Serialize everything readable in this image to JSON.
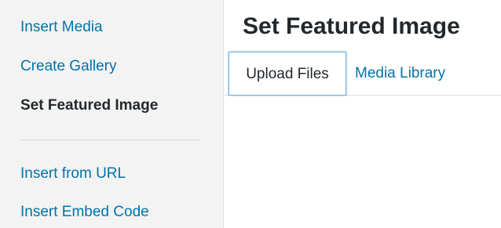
{
  "sidebar": {
    "items": [
      {
        "label": "Insert Media"
      },
      {
        "label": "Create Gallery"
      },
      {
        "label": "Set Featured Image"
      },
      {
        "label": "Insert from URL"
      },
      {
        "label": "Insert Embed Code"
      }
    ],
    "active_item": "Set Featured Image"
  },
  "frame": {
    "title": "Set Featured Image"
  },
  "router": {
    "tabs": [
      {
        "label": "Upload Files"
      },
      {
        "label": "Media Library"
      }
    ],
    "active_tab": "Upload Files"
  },
  "colors": {
    "link": "#0073aa",
    "text": "#23282d",
    "sidebar_bg": "#f3f3f3",
    "active_tab_border": "#7fb5d5"
  }
}
